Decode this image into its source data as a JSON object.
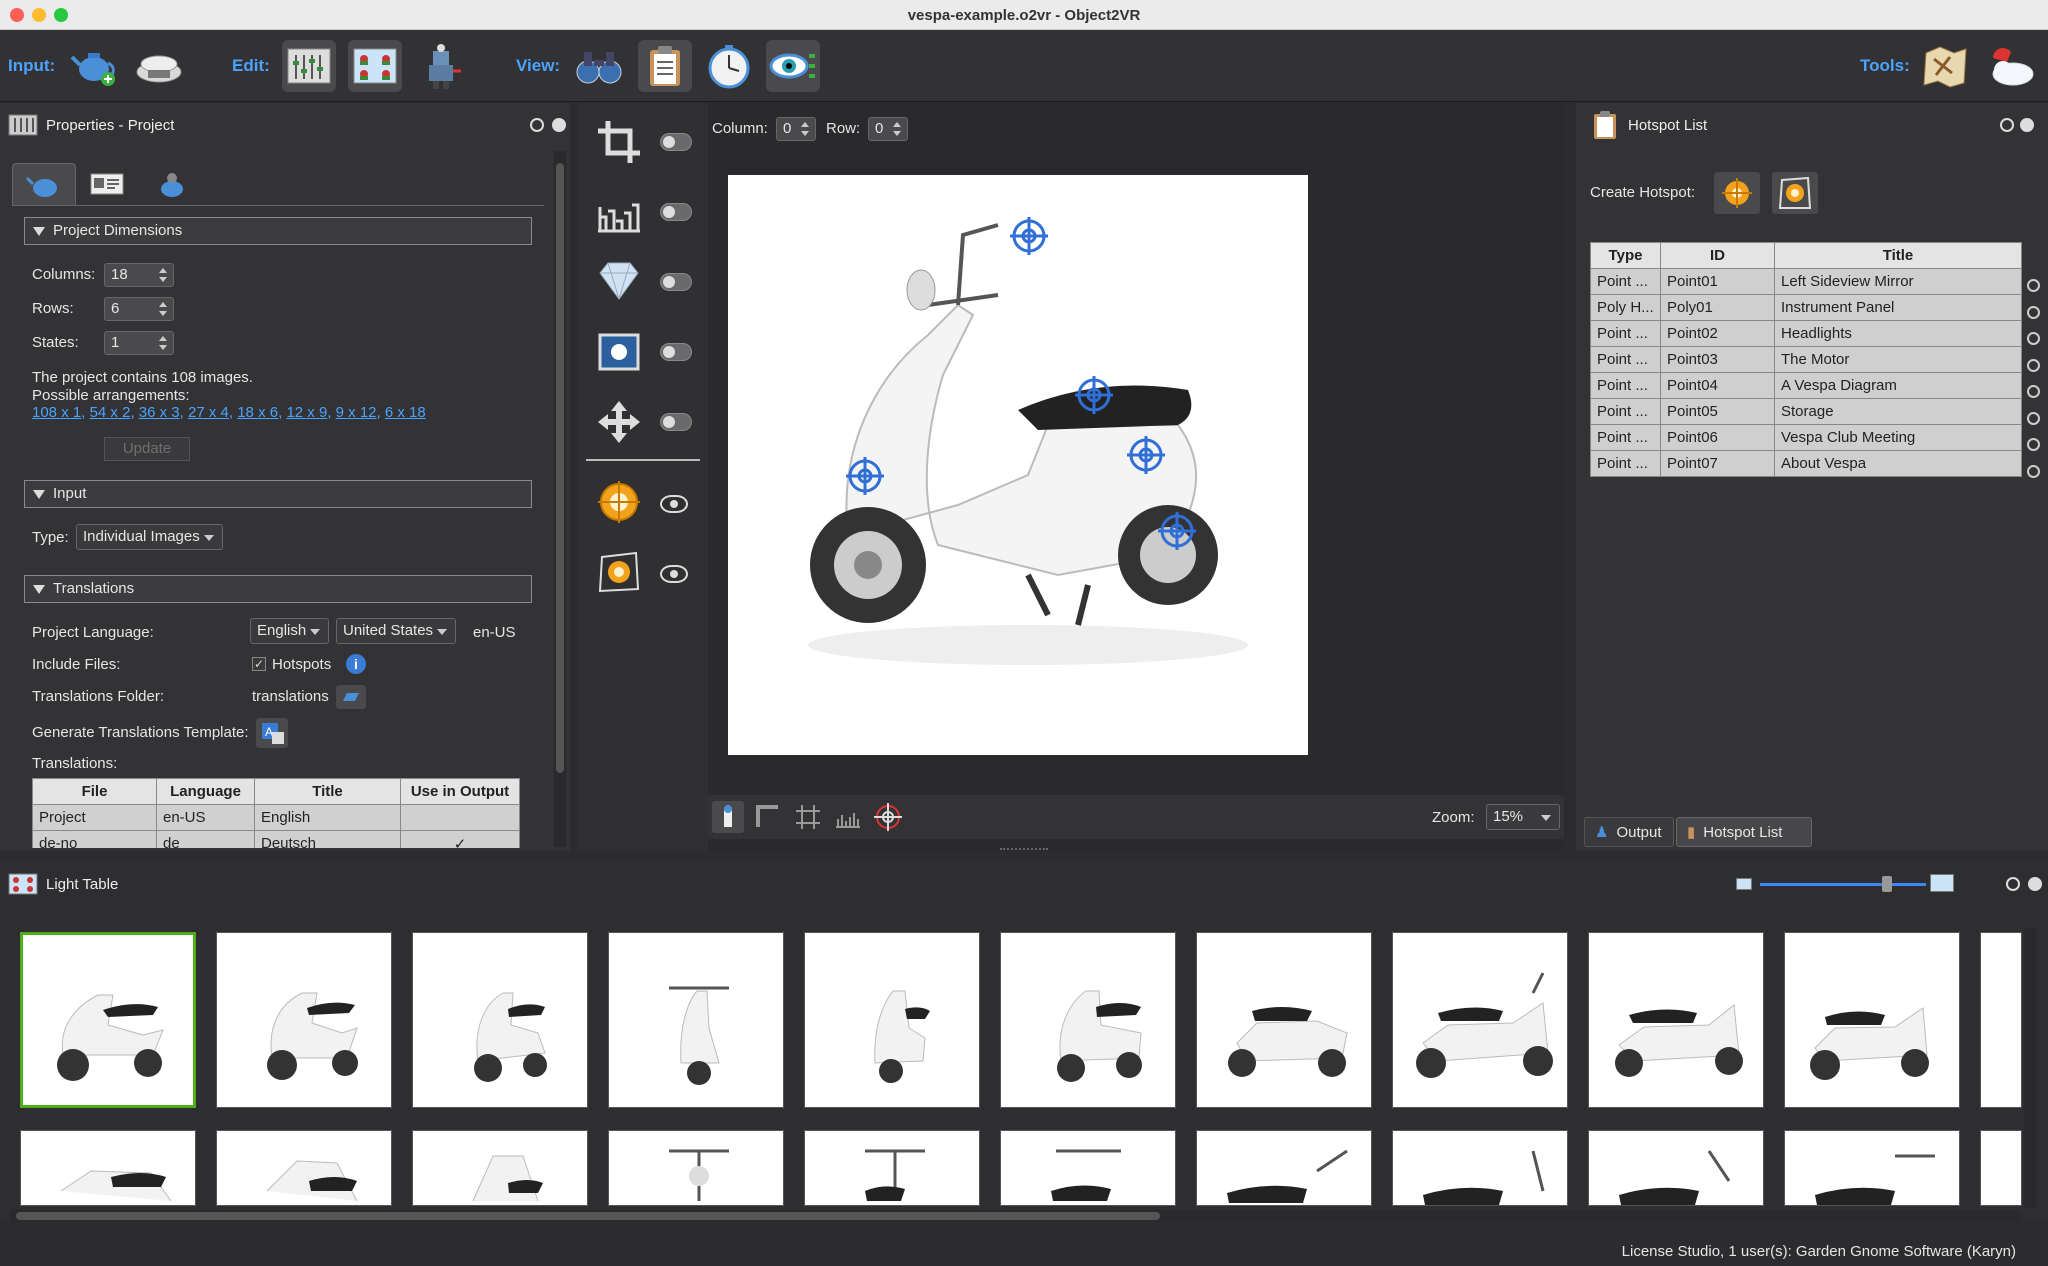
{
  "window": {
    "title": "vespa-example.o2vr - Object2VR"
  },
  "toolbar": {
    "input_label": "Input:",
    "edit_label": "Edit:",
    "view_label": "View:",
    "tools_label": "Tools:"
  },
  "properties": {
    "title": "Properties - Project",
    "project_dimensions": {
      "header": "Project Dimensions",
      "columns_label": "Columns:",
      "columns_value": "18",
      "rows_label": "Rows:",
      "rows_value": "6",
      "states_label": "States:",
      "states_value": "1",
      "info_line1": "The project contains 108 images.",
      "info_line2": "Possible arrangements:",
      "arrangements": [
        "108 x 1",
        "54 x 2",
        "36 x 3",
        "27 x 4",
        "18 x 6",
        "12 x 9",
        "9 x 12",
        "6 x 18"
      ],
      "update_button": "Update"
    },
    "input": {
      "header": "Input",
      "type_label": "Type:",
      "type_value": "Individual Images"
    },
    "translations": {
      "header": "Translations",
      "project_language_label": "Project Language:",
      "language_value": "English",
      "country_value": "United States",
      "locale_code": "en-US",
      "include_files_label": "Include Files:",
      "hotspots_checkbox": "Hotspots",
      "folder_label": "Translations Folder:",
      "folder_value": "translations",
      "template_label": "Generate Translations Template:",
      "translations_label": "Translations:",
      "table_headers": [
        "File",
        "Language",
        "Title",
        "Use in Output"
      ],
      "rows": [
        {
          "file": "Project",
          "language": "en-US",
          "title": "English",
          "use": ""
        },
        {
          "file": "de-no",
          "language": "de",
          "title": "Deutsch",
          "use": "✓"
        }
      ]
    }
  },
  "viewer": {
    "column_label": "Column:",
    "column_value": "0",
    "row_label": "Row:",
    "row_value": "0",
    "zoom_label": "Zoom:",
    "zoom_value": "15%"
  },
  "hotspot_list": {
    "title": "Hotspot List",
    "create_label": "Create Hotspot:",
    "headers": [
      "Type",
      "ID",
      "Title"
    ],
    "rows": [
      {
        "type": "Point ...",
        "id": "Point01",
        "title": "Left Sideview Mirror"
      },
      {
        "type": "Poly H...",
        "id": "Poly01",
        "title": "Instrument Panel"
      },
      {
        "type": "Point ...",
        "id": "Point02",
        "title": "Headlights"
      },
      {
        "type": "Point ...",
        "id": "Point03",
        "title": "The Motor"
      },
      {
        "type": "Point ...",
        "id": "Point04",
        "title": "A Vespa Diagram"
      },
      {
        "type": "Point ...",
        "id": "Point05",
        "title": "Storage"
      },
      {
        "type": "Point ...",
        "id": "Point06",
        "title": "Vespa Club Meeting"
      },
      {
        "type": "Point ...",
        "id": "Point07",
        "title": "About Vespa"
      }
    ],
    "tab_output": "Output",
    "tab_hotspot_list": "Hotspot List"
  },
  "light_table": {
    "title": "Light Table",
    "slider_value": 0.78
  },
  "status": {
    "text": "License Studio, 1 user(s): Garden Gnome Software (Karyn)"
  },
  "colors": {
    "accent": "#4aa3ff",
    "selection": "#4caf1a",
    "hotspot": "#2f6fd6"
  }
}
